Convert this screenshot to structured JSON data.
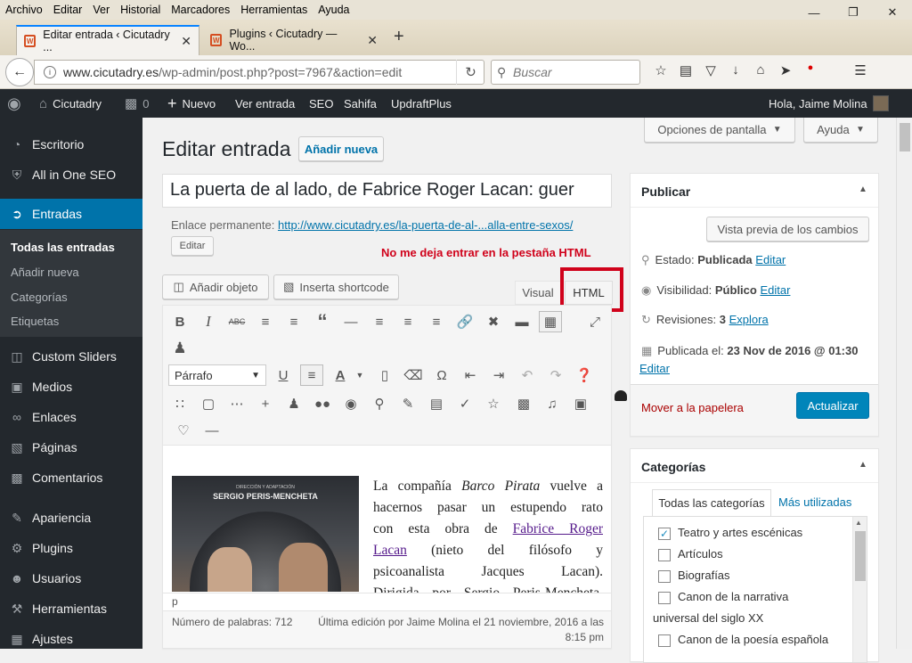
{
  "menubar": [
    "Archivo",
    "Editar",
    "Ver",
    "Historial",
    "Marcadores",
    "Herramientas",
    "Ayuda"
  ],
  "tabs": [
    {
      "label": "Editar entrada ‹ Cicutadry ..."
    },
    {
      "label": "Plugins ‹ Cicutadry — Wo..."
    }
  ],
  "nav": {
    "url_domain": "www.cicutadry.es",
    "url_path": "/wp-admin/post.php?post=7967&action=edit",
    "search_placeholder": "Buscar"
  },
  "adminbar": {
    "site": "Cicutadry",
    "comments": "0",
    "new": "Nuevo",
    "view": "Ver entrada",
    "seo": "SEO",
    "sahifa": "Sahifa",
    "updraft": "UpdraftPlus",
    "greeting": "Hola, Jaime Molina"
  },
  "sidebar": {
    "items": [
      "Escritorio",
      "All in One SEO",
      "Entradas",
      "Custom Sliders",
      "Medios",
      "Enlaces",
      "Páginas",
      "Comentarios",
      "Apariencia",
      "Plugins",
      "Usuarios",
      "Herramientas",
      "Ajustes"
    ],
    "sub": [
      "Todas las entradas",
      "Añadir nueva",
      "Categorías",
      "Etiquetas"
    ]
  },
  "header": {
    "title": "Editar entrada",
    "add_new": "Añadir nueva",
    "screen_options": "Opciones de pantalla",
    "help": "Ayuda"
  },
  "post": {
    "title": "La puerta de al lado, de Fabrice Roger Lacan: guer",
    "permalink_label": "Enlace permanente:",
    "permalink": "http://www.cicutadry.es/la-puerta-de-al-...alla-entre-sexos/",
    "edit": "Editar",
    "annotation": "No me deja entrar en la pestaña HTML"
  },
  "editor": {
    "add_media": "Añadir objeto",
    "shortcode": "Inserta shortcode",
    "tab_visual": "Visual",
    "tab_html": "HTML",
    "format": "Párrafo",
    "poster_text": "DIRECCIÓN Y ADAPTACIÓN",
    "poster_name": "SERGIO PERIS-MENCHETA",
    "path": "p",
    "word_count": "Número de palabras: 712",
    "last_edit": "Última edición por Jaime Molina el 21 noviembre, 2016 a las 8:15 pm",
    "content_lines": [
      {
        "parts": [
          {
            "t": "La compañía "
          },
          {
            "t": "Barco Pirata",
            "i": true
          },
          {
            "t": " vuelve a"
          }
        ]
      },
      {
        "parts": [
          {
            "t": "hacernos pasar un estupendo rato"
          }
        ]
      },
      {
        "parts": [
          {
            "t": "con esta obra de "
          },
          {
            "t": "Fabrice Roger",
            "l": true
          }
        ]
      },
      {
        "parts": [
          {
            "t": "Lacan",
            "l": true
          },
          {
            "t": " (nieto del filósofo y"
          }
        ]
      },
      {
        "parts": [
          {
            "t": "psicoanalista Jacques Lacan)."
          }
        ]
      },
      {
        "parts": [
          {
            "t": "Dirigida por Sergio Peris-Mencheta,"
          }
        ]
      }
    ]
  },
  "publish": {
    "title": "Publicar",
    "preview": "Vista previa de los cambios",
    "status_label": "Estado:",
    "status": "Publicada",
    "edit": "Editar",
    "visibility_label": "Visibilidad:",
    "visibility": "Público",
    "revisions_label": "Revisiones:",
    "revisions": "3",
    "explore": "Explora",
    "published_label": "Publicada el:",
    "published": "23 Nov de 2016 @ 01:30",
    "trash": "Mover a la papelera",
    "update": "Actualizar"
  },
  "categories": {
    "title": "Categorías",
    "tab_all": "Todas las categorías",
    "tab_used": "Más utilizadas",
    "items": [
      {
        "label": "Teatro y artes escénicas",
        "checked": true
      },
      {
        "label": "Artículos",
        "checked": false
      },
      {
        "label": "Biografías",
        "checked": false
      },
      {
        "label": "Canon de la narrativa",
        "checked": false
      },
      {
        "label": "universal del siglo XX",
        "checked": false
      },
      {
        "label": "Canon de la poesía española",
        "checked": false
      }
    ]
  },
  "colors": {
    "accent": "#0073aa",
    "annotation": "#d0021b",
    "trash": "#a00"
  }
}
